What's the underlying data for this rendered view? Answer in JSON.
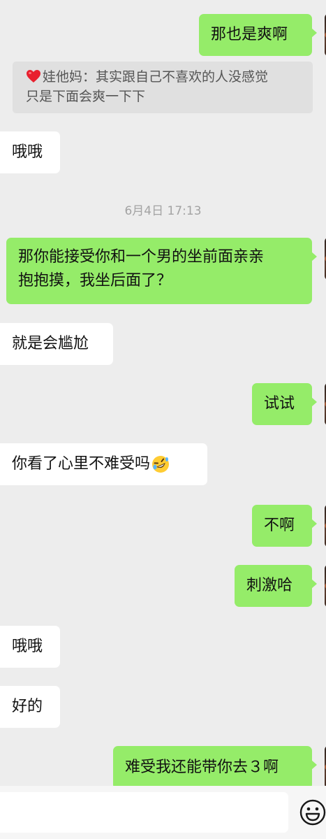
{
  "conversation": {
    "messages": [
      {
        "side": "sent",
        "text": "那也是爽啊"
      },
      {
        "side": "recv",
        "text": "哦哦"
      },
      {
        "side": "sent",
        "line1": "那你能接受你和一个男的坐前面亲亲",
        "line2": "抱抱摸，我坐后面了？"
      },
      {
        "side": "recv",
        "text": "就是会尴尬"
      },
      {
        "side": "sent",
        "text": "试试"
      },
      {
        "side": "recv",
        "text": "你看了心里不难受吗"
      },
      {
        "side": "sent",
        "text": "不啊"
      },
      {
        "side": "sent",
        "text": "刺激哈"
      },
      {
        "side": "recv",
        "text": "哦哦"
      },
      {
        "side": "recv",
        "text": "好的"
      },
      {
        "side": "sent",
        "text": "难受我还能带你去３啊"
      }
    ],
    "quote": {
      "sender": "娃他妈：",
      "line1": "其实跟自己不喜欢的人没感觉",
      "line2": "只是下面会爽一下下"
    },
    "timestamp": "6月4日 17:13"
  },
  "colors": {
    "sent_bubble": "#95ec69",
    "recv_bubble": "#ffffff",
    "background": "#ededed"
  },
  "icons": {
    "quote_prefix": "heart-icon",
    "message_emoji": "rofl-emoji-icon",
    "input_emoji": "smiley-face-icon"
  }
}
